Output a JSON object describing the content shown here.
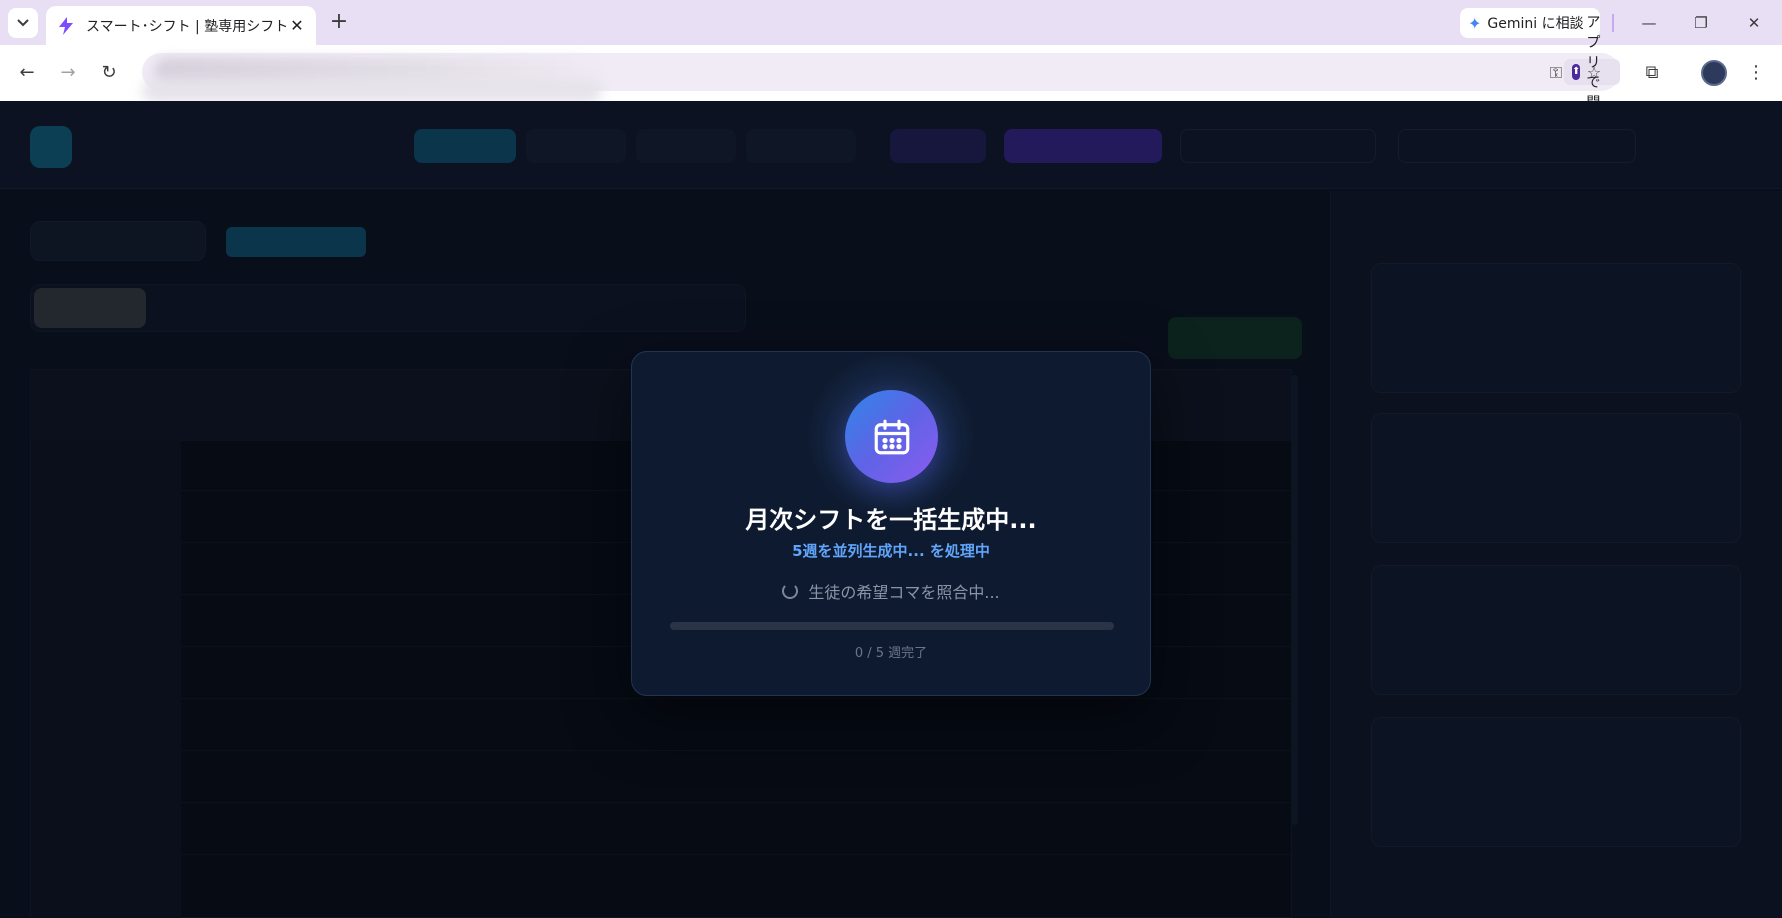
{
  "browser": {
    "tab_title": "スマート･シフト | 塾専用シフト管理",
    "gemini_label": "Gemini に相談",
    "open_app_label": "アプリで開く",
    "accent_tab_bar": "#e9dff5"
  },
  "modal": {
    "title": "月次シフトを一括生成中...",
    "subtitle": "5週を並列生成中... を処理中",
    "status": "生徒の希望コマを照合中...",
    "progress_text": "0 / 5 週完了",
    "progress_fraction": 0,
    "icon": "calendar-icon",
    "accent_color": "#60a5fa"
  }
}
